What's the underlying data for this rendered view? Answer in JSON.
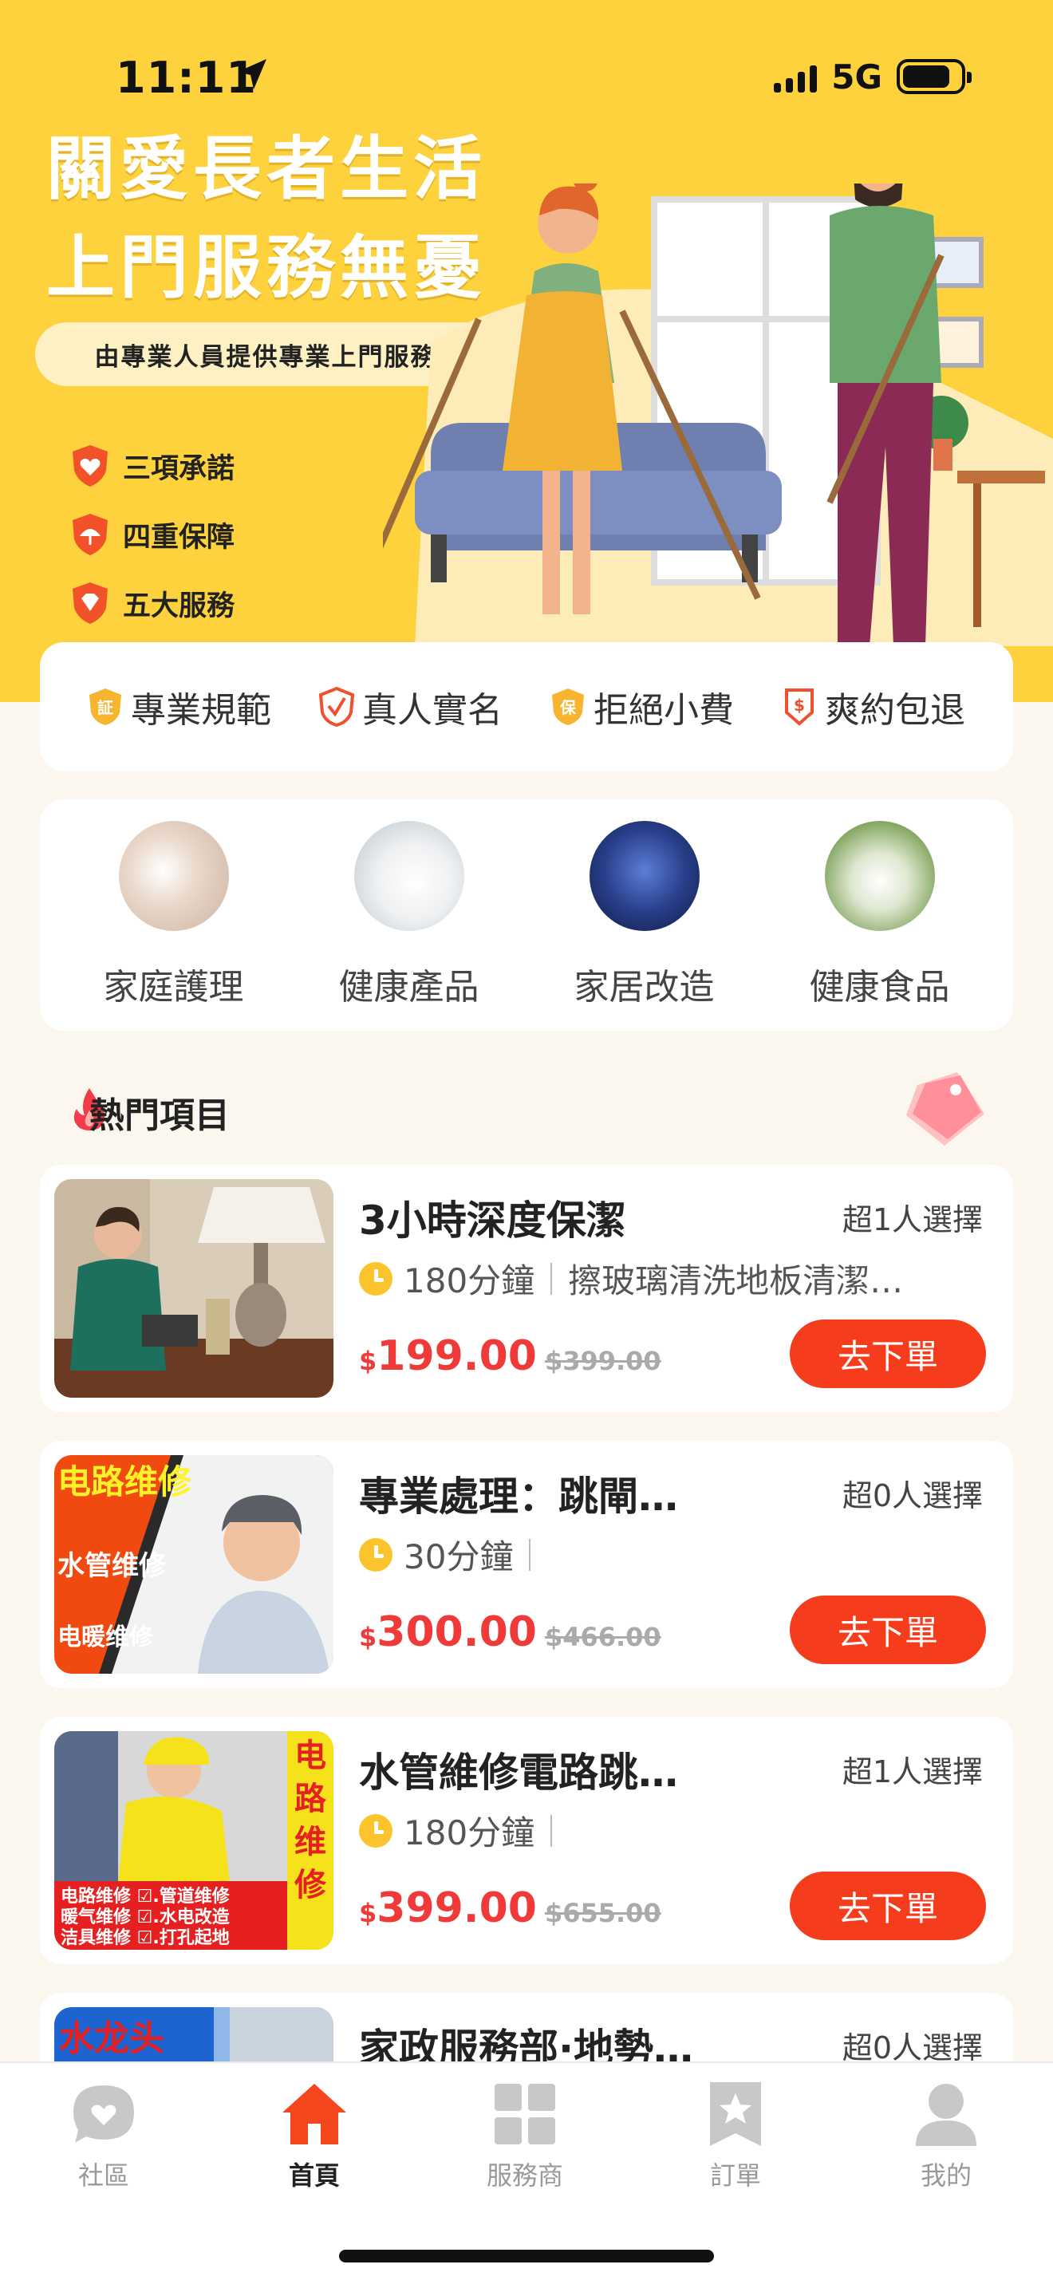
{
  "status_bar": {
    "time": "11:11",
    "network": "5G"
  },
  "hero": {
    "title_line1": "關愛長者生活",
    "title_line2": "上門服務無憂",
    "subtitle": "由專業人員提供專業上門服務",
    "promises": [
      "三項承諾",
      "四重保障",
      "五大服務"
    ]
  },
  "badges": [
    {
      "label": "專業規範",
      "icon": "certificate-icon"
    },
    {
      "label": "真人實名",
      "icon": "verified-shield-icon"
    },
    {
      "label": "拒絕小費",
      "icon": "guarantee-icon"
    },
    {
      "label": "爽約包退",
      "icon": "refund-icon"
    }
  ],
  "categories": [
    {
      "label": "家庭護理"
    },
    {
      "label": "健康產品"
    },
    {
      "label": "家居改造"
    },
    {
      "label": "健康食品"
    }
  ],
  "hot": {
    "title": "熱門項目"
  },
  "services": [
    {
      "title": "3小時深度保潔",
      "count": "超1人選擇",
      "duration": "180分鐘",
      "desc": "擦玻璃清洗地板清潔…",
      "currency": "$",
      "price": "199.00",
      "original": "$399.00",
      "button": "去下單"
    },
    {
      "title": "專業處理：跳閘…",
      "count": "超0人選擇",
      "duration": "30分鐘",
      "desc": "",
      "currency": "$",
      "price": "300.00",
      "original": "$466.00",
      "button": "去下單",
      "thumb_text": [
        "电路维修",
        "水管维修",
        "电暖维修"
      ]
    },
    {
      "title": "水管維修電路跳…",
      "count": "超1人選擇",
      "duration": "180分鐘",
      "desc": "",
      "currency": "$",
      "price": "399.00",
      "original": "$655.00",
      "button": "去下單",
      "thumb_text": [
        "电路维修",
        "电路维修 ☑.管道维修",
        "暖气维修 ☑.水电改造",
        "洁具维修 ☑.打孔起地"
      ]
    },
    {
      "title": "家政服務部·地勢…",
      "count": "超0人選擇",
      "thumb_text": [
        "水龙头"
      ]
    }
  ],
  "tabs": [
    {
      "label": "社區",
      "icon": "chat-bubble-icon",
      "active": false
    },
    {
      "label": "首頁",
      "icon": "home-icon",
      "active": true
    },
    {
      "label": "服務商",
      "icon": "grid-icon",
      "active": false
    },
    {
      "label": "訂單",
      "icon": "bookmark-star-icon",
      "active": false
    },
    {
      "label": "我的",
      "icon": "person-icon",
      "active": false
    }
  ],
  "colors": {
    "brand_yellow": "#fdd23c",
    "accent_red": "#f53c1c",
    "price_red": "#f03a3a"
  }
}
